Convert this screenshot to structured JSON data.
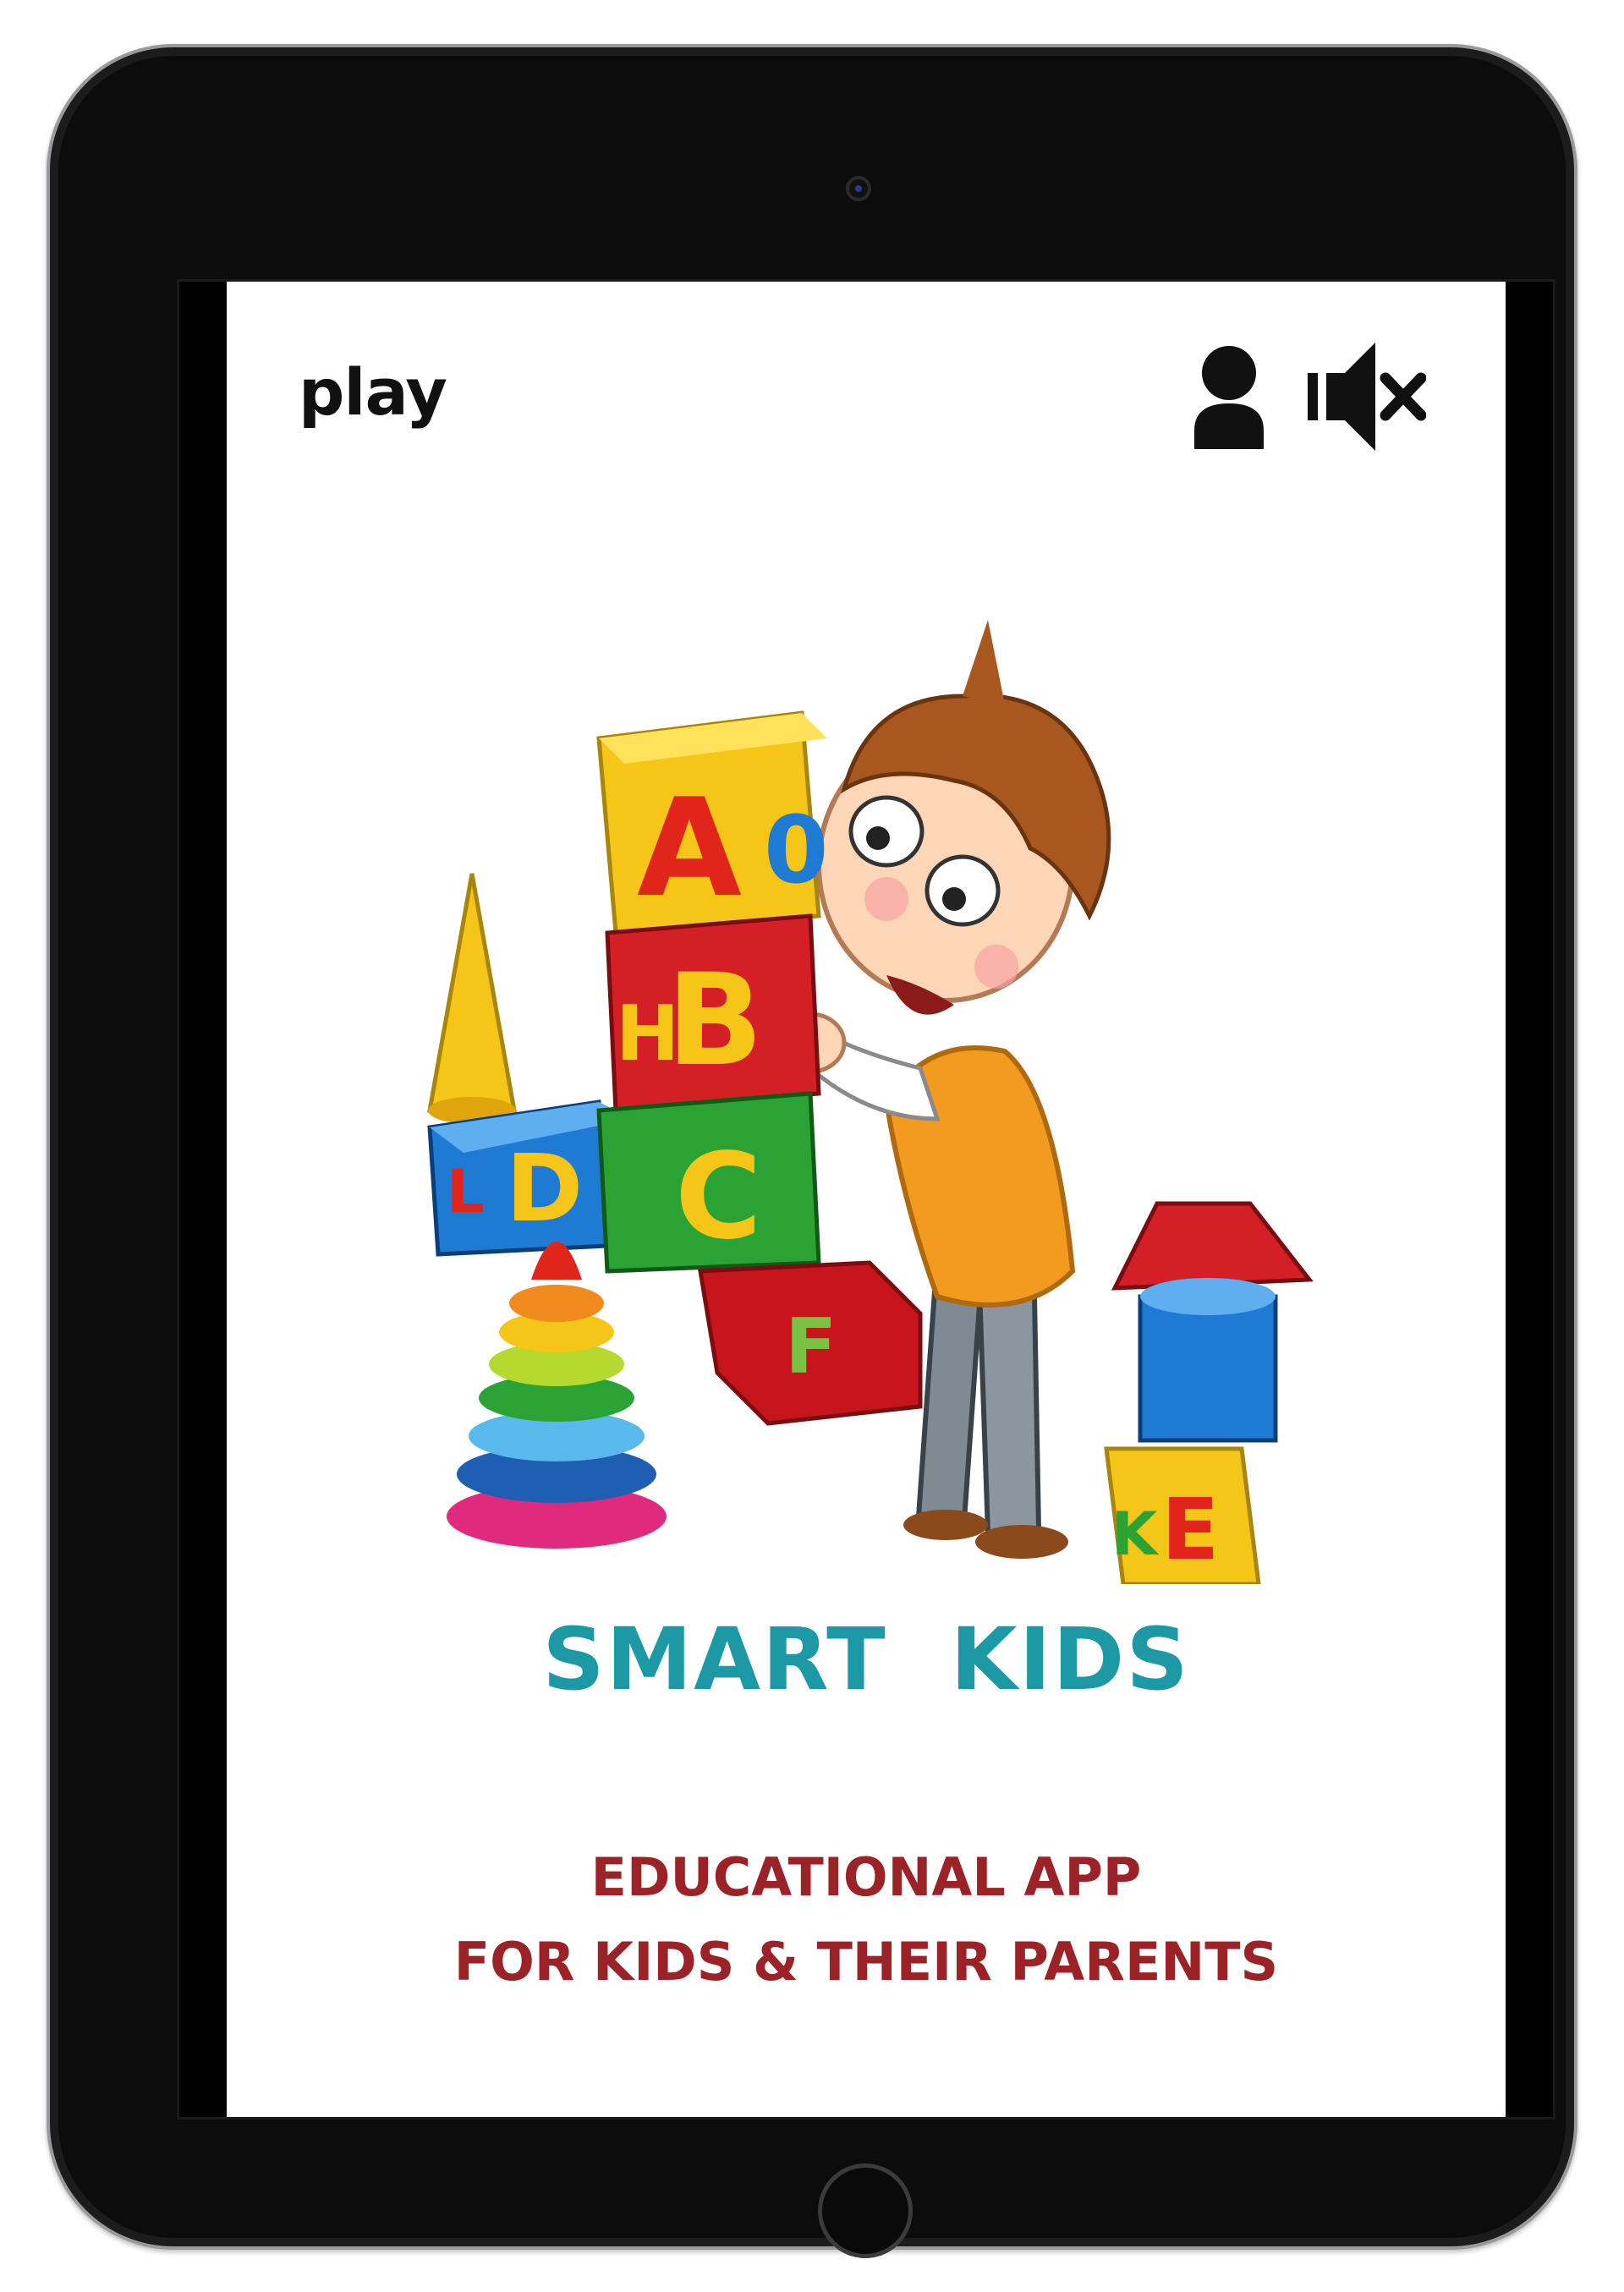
{
  "header": {
    "play_label": "play",
    "profile_icon": "user-icon",
    "sound_icon": "speaker-muted-icon"
  },
  "hero": {
    "illustration": "boy-with-alphabet-blocks",
    "block_letters": [
      "A",
      "0",
      "H",
      "B",
      "C",
      "F",
      "L",
      "D",
      "K",
      "E"
    ]
  },
  "app": {
    "title": "SMART  KIDS",
    "tagline_line1": "EDUCATIONAL APP",
    "tagline_line2": "FOR KIDS & THEIR PARENTS"
  },
  "colors": {
    "title": "#1d98a5",
    "tagline": "#9b2226",
    "icon": "#111111"
  }
}
